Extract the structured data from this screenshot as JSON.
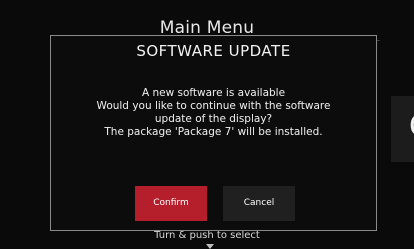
{
  "background": {
    "menu_title": "Main Menu",
    "side_glyph": "C",
    "hint": "Turn & push to select"
  },
  "dialog": {
    "title": "SOFTWARE UPDATE",
    "message_lines": [
      "A new software is available",
      "Would you like to continue with the software",
      "update of the display?",
      "The package 'Package 7' will be installed."
    ],
    "confirm_label": "Confirm",
    "cancel_label": "Cancel"
  },
  "colors": {
    "confirm_button": "#b51f2b",
    "cancel_button": "#202020",
    "dialog_border": "#8a8a8a"
  },
  "icons": {
    "hint_arrow": "chevron-down-icon"
  }
}
